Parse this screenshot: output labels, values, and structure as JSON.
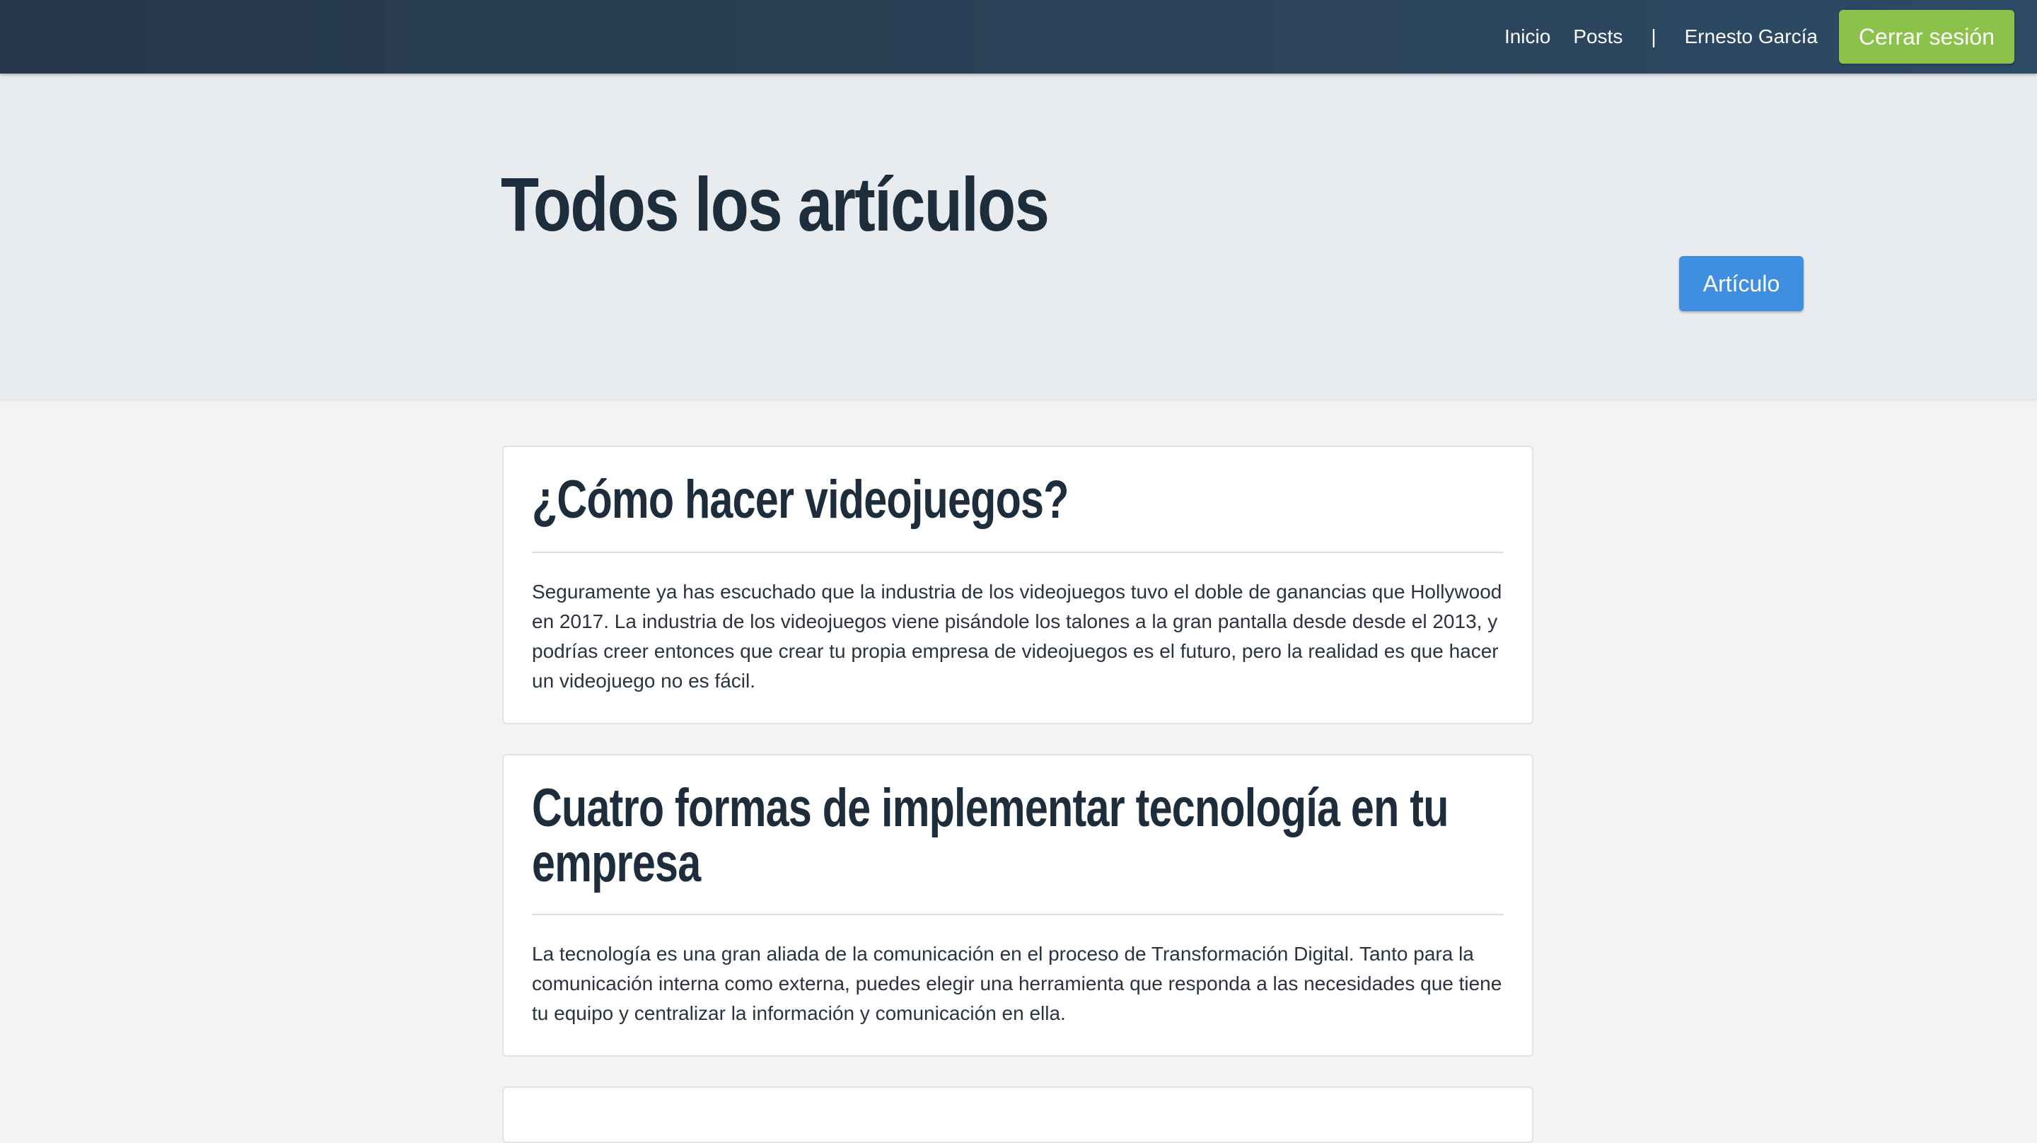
{
  "nav": {
    "inicio": "Inicio",
    "posts": "Posts",
    "separator": "|",
    "user": "Ernesto García",
    "logout": "Cerrar sesión"
  },
  "hero": {
    "title": "Todos los artículos",
    "new_article_button": "Artículo"
  },
  "articles": [
    {
      "title": "¿Cómo hacer videojuegos?",
      "excerpt": "Seguramente ya has escuchado que la industria de los videojuegos tuvo el doble de ganancias que Hollywood en 2017. La industria de los videojuegos viene pisándole los talones a la gran pantalla desde desde el 2013, y podrías creer entonces que crear tu propia empresa de videojuegos es el futuro, pero la realidad es que hacer un videojuego no es fácil."
    },
    {
      "title": "Cuatro formas de implementar tecnología en tu empresa",
      "excerpt": "La tecnología es una gran aliada de la comunicación en el proceso de Transformación Digital. Tanto para la comunicación interna como externa, puedes elegir una herramienta que responda a las necesidades que tiene tu equipo y centralizar la información y comunicación en ella."
    }
  ],
  "colors": {
    "navbar": "#2a4157",
    "logout_button": "#8bc34a",
    "primary_button": "#3f8ee0",
    "hero_background": "#e9ecef",
    "page_background": "#f3f3f3",
    "heading_text": "#1e2d3b"
  }
}
